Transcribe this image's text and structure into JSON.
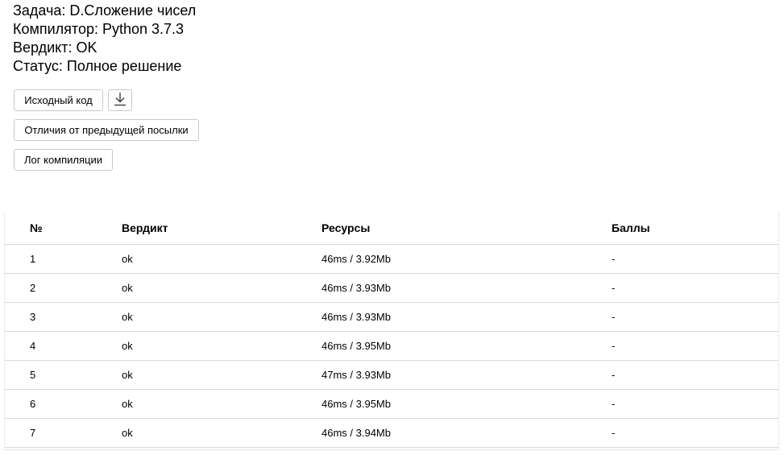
{
  "submission": {
    "task": "Задача: D.Сложение чисел",
    "compiler": "Компилятор: Python 3.7.3",
    "verdict": "Вердикт: OK",
    "status": "Статус: Полное решение"
  },
  "buttons": {
    "source_code": "Исходный код",
    "download_icon": "download-icon",
    "diff": "Отличия от предыдущей посылки",
    "compile_log": "Лог компиляции"
  },
  "table": {
    "headers": {
      "num": "№",
      "verdict": "Вердикт",
      "resources": "Ресурсы",
      "score": "Баллы"
    },
    "rows": [
      {
        "num": "1",
        "verdict": "ok",
        "resources": "46ms / 3.92Mb",
        "score": "-"
      },
      {
        "num": "2",
        "verdict": "ok",
        "resources": "46ms / 3.93Mb",
        "score": "-"
      },
      {
        "num": "3",
        "verdict": "ok",
        "resources": "46ms / 3.93Mb",
        "score": "-"
      },
      {
        "num": "4",
        "verdict": "ok",
        "resources": "46ms / 3.95Mb",
        "score": "-"
      },
      {
        "num": "5",
        "verdict": "ok",
        "resources": "47ms / 3.93Mb",
        "score": "-"
      },
      {
        "num": "6",
        "verdict": "ok",
        "resources": "46ms / 3.95Mb",
        "score": "-"
      },
      {
        "num": "7",
        "verdict": "ok",
        "resources": "46ms / 3.94Mb",
        "score": "-"
      }
    ]
  },
  "colors": {
    "border": "#c8c8c8",
    "row_divider": "#d9d9d9"
  }
}
